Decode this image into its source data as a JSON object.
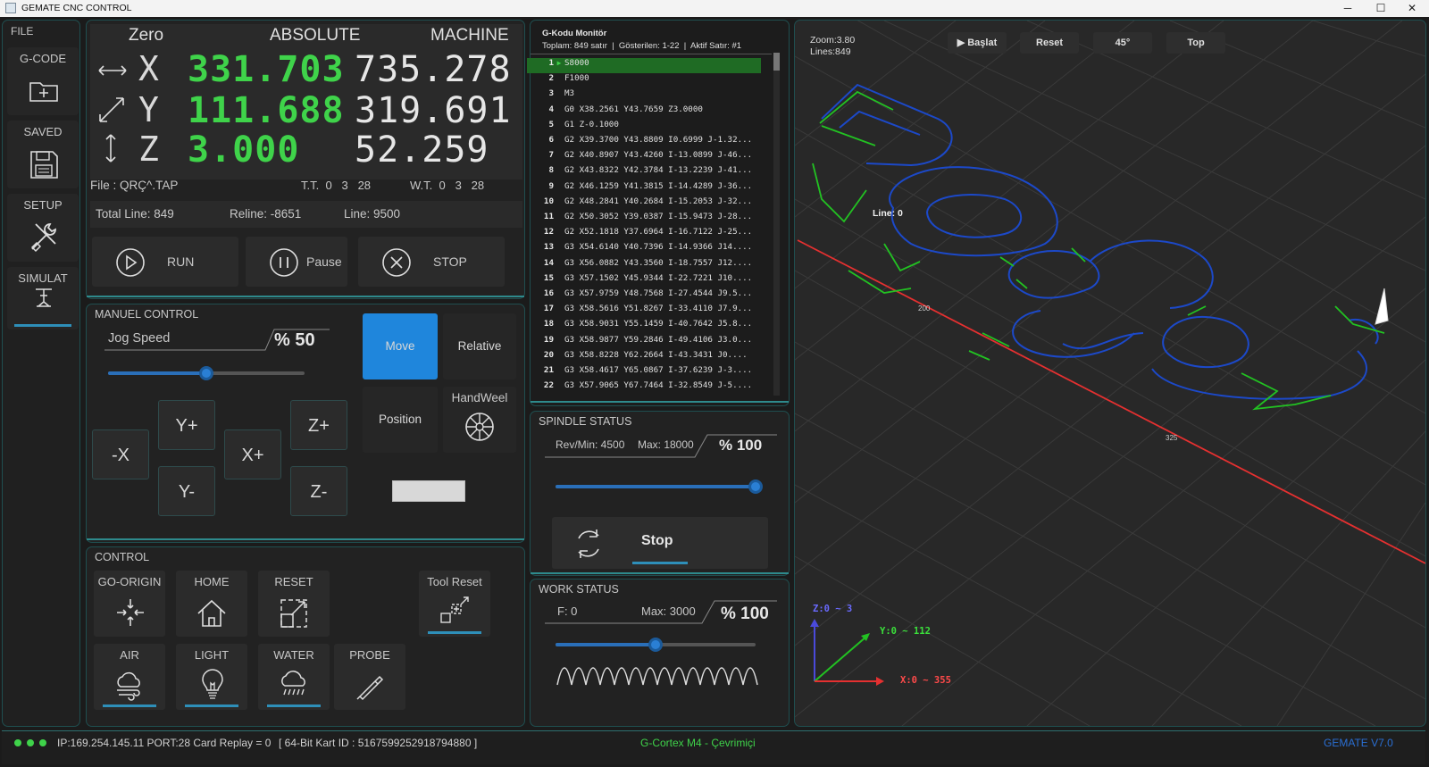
{
  "window": {
    "title": "GEMATE CNC CONTROL",
    "minimize": "─",
    "maximize": "☐",
    "close": "✕"
  },
  "sidebar": {
    "file_label": "FILE",
    "items": [
      {
        "label": "G-CODE",
        "icon": "folder-add-icon"
      },
      {
        "label": "SAVED",
        "icon": "save-icon"
      },
      {
        "label": "SETUP",
        "icon": "tools-icon"
      },
      {
        "label": "SIMULAT",
        "icon": "simulate-icon"
      }
    ]
  },
  "dro": {
    "header": {
      "zero": "Zero",
      "absolute": "ABSOLUTE",
      "machine": "MACHINE"
    },
    "axes": [
      {
        "axis": "X",
        "absolute": "331.703",
        "machine": "735.278"
      },
      {
        "axis": "Y",
        "absolute": "111.688",
        "machine": "319.691"
      },
      {
        "axis": "Z",
        "absolute": "3.000",
        "machine": "52.259"
      }
    ],
    "file": "File :  QRÇ^.TAP",
    "tt": "T.T.  0   3   28",
    "wt": "W.T.  0   3   28",
    "total_line": "Total Line: 849",
    "reline": "Reline: -8651",
    "line": "Line: 9500"
  },
  "run_controls": {
    "run": "RUN",
    "pause": "Pause",
    "stop": "STOP"
  },
  "manual": {
    "title": "MANUEL CONTROL",
    "jog_speed_label": "Jog Speed",
    "jog_speed_value": "% 50",
    "jog_speed_fraction": 0.5,
    "move": "Move",
    "relative": "Relative",
    "position": "Position",
    "handwheel": "HandWeel",
    "jog": {
      "xminus": "-X",
      "yplus": "Y+",
      "xplus": "X+",
      "yminus": "Y-",
      "zplus": "Z+",
      "zminus": "Z-"
    }
  },
  "control": {
    "title": "CONTROL",
    "go_origin": "GO-ORIGIN",
    "home": "HOME",
    "reset": "RESET",
    "tool_reset": "Tool Reset",
    "air": "AIR",
    "light": "LIGHT",
    "water": "WATER",
    "probe": "PROBE"
  },
  "gcode": {
    "title": "G-Kodu Monitör",
    "summary": "Toplam: 849 satır  |  Gösterilen: 1-22  |  Aktif Satır: #1",
    "active_arrow": "▶",
    "lines": [
      {
        "n": "1",
        "code": "S8000"
      },
      {
        "n": "2",
        "code": "F1000"
      },
      {
        "n": "3",
        "code": "M3"
      },
      {
        "n": "4",
        "code": "G0 X38.2561 Y43.7659 Z3.0000"
      },
      {
        "n": "5",
        "code": "G1   Z-0.1000"
      },
      {
        "n": "6",
        "code": "G2 X39.3700 Y43.8809 I0.6999 J-1.32..."
      },
      {
        "n": "7",
        "code": "G2 X40.8907 Y43.4260 I-13.0899 J-46..."
      },
      {
        "n": "8",
        "code": "G2 X43.8322 Y42.3784 I-13.2239 J-41..."
      },
      {
        "n": "9",
        "code": "G2 X46.1259 Y41.3815 I-14.4289 J-36..."
      },
      {
        "n": "10",
        "code": "G2 X48.2841 Y40.2684 I-15.2053 J-32..."
      },
      {
        "n": "11",
        "code": "G2 X50.3052 Y39.0387 I-15.9473 J-28..."
      },
      {
        "n": "12",
        "code": "G2 X52.1818 Y37.6964 I-16.7122 J-25..."
      },
      {
        "n": "13",
        "code": "G3 X54.6140 Y40.7396 I-14.9366 J14...."
      },
      {
        "n": "14",
        "code": "G3 X56.0882 Y43.3560 I-18.7557 J12...."
      },
      {
        "n": "15",
        "code": "G3 X57.1502 Y45.9344 I-22.7221 J10...."
      },
      {
        "n": "16",
        "code": "G3 X57.9759 Y48.7568 I-27.4544 J9.5..."
      },
      {
        "n": "17",
        "code": "G3 X58.5616 Y51.8267 I-33.4110 J7.9..."
      },
      {
        "n": "18",
        "code": "G3 X58.9031 Y55.1459 I-40.7642 J5.8..."
      },
      {
        "n": "19",
        "code": "G3 X58.9877 Y59.2846 I-49.4106 J3.0..."
      },
      {
        "n": "20",
        "code": "G3 X58.8228 Y62.2664 I-43.3431 J0...."
      },
      {
        "n": "21",
        "code": "G3 X58.4617 Y65.0867 I-37.6239 J-3...."
      },
      {
        "n": "22",
        "code": "G3 X57.9065 Y67.7464 I-32.8549 J-5...."
      }
    ]
  },
  "spindle": {
    "title": "SPINDLE STATUS",
    "rev": "Rev/Min: 4500",
    "max": "Max: 18000",
    "percent": "% 100",
    "fraction": 1.0,
    "button": "Stop"
  },
  "work": {
    "title": "WORK STATUS",
    "feed": "F: 0",
    "max": "Max: 3000",
    "percent": "% 100",
    "fraction": 0.5
  },
  "viewer": {
    "zoom": "Zoom:3.80",
    "lines": "Lines:849",
    "buttons": {
      "start": "▶ Başlat",
      "reset": "Reset",
      "angle": "45°",
      "top": "Top"
    },
    "line_label": "Line: 0",
    "tick_200": "200",
    "tick_325": "325",
    "axis_z": "Z:0 ~ 3",
    "axis_y": "Y:0 ~ 112",
    "axis_x": "X:0 ~ 355"
  },
  "status": {
    "connection": "IP:169.254.145.11 PORT:28 Card Replay = 0",
    "card_id": "[ 64-Bit Kart ID : 5167599252918794880 ]",
    "device": "G-Cortex M4 - Çevrimiçi",
    "version": "GEMATE V7.0"
  },
  "colors": {
    "accent": "#1f8ad6",
    "dro_green": "#3fd34a",
    "toolpath": "#1c49c9",
    "rapid": "#22c222",
    "x_axis": "#e53030"
  }
}
